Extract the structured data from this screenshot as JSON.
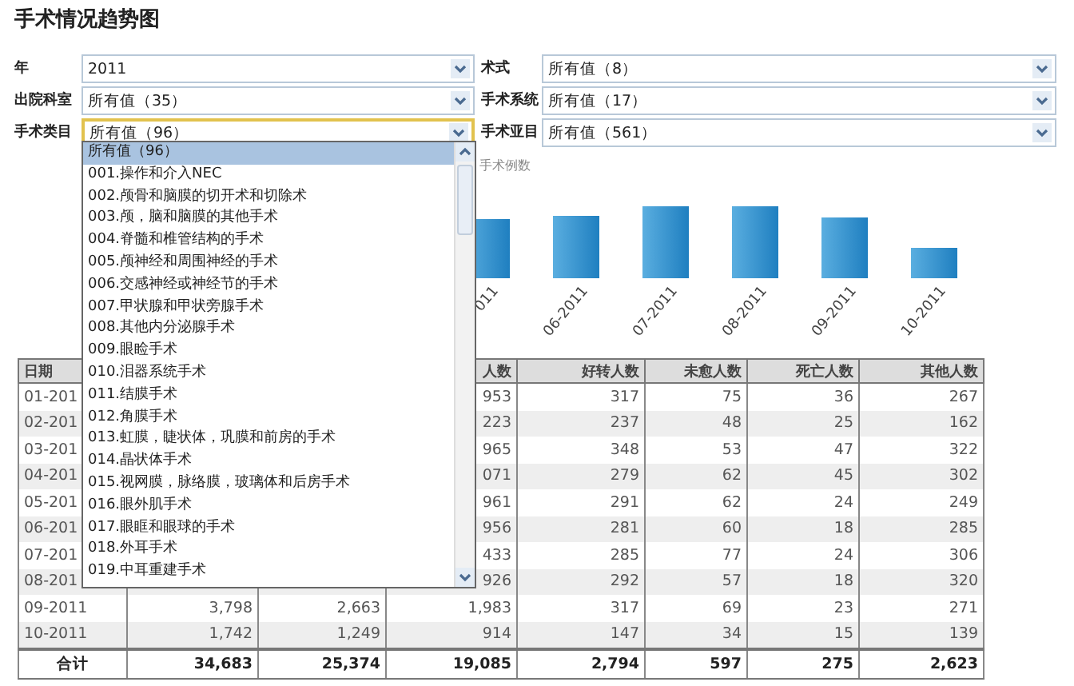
{
  "title": "手术情况趋势图",
  "filters": [
    {
      "label": "年",
      "value": "2011",
      "focused": false
    },
    {
      "label": "术式",
      "value": "所有值（8）",
      "focused": false
    },
    {
      "label": "出院科室",
      "value": "所有值（35）",
      "focused": false
    },
    {
      "label": "手术系统",
      "value": "所有值（17）",
      "focused": false
    },
    {
      "label": "手术类目",
      "value": "所有值（96）",
      "focused": true
    },
    {
      "label": "手术亚目",
      "value": "所有值（561）",
      "focused": false
    }
  ],
  "dropdown": {
    "options": [
      {
        "label": "所有值（96）",
        "selected": true
      },
      {
        "label": "001.操作和介入NEC",
        "selected": false
      },
      {
        "label": "002.颅骨和脑膜的切开术和切除术",
        "selected": false
      },
      {
        "label": "003.颅，脑和脑膜的其他手术",
        "selected": false
      },
      {
        "label": "004.脊髓和椎管结构的手术",
        "selected": false
      },
      {
        "label": "005.颅神经和周围神经的手术",
        "selected": false
      },
      {
        "label": "006.交感神经或神经节的手术",
        "selected": false
      },
      {
        "label": "007.甲状腺和甲状旁腺手术",
        "selected": false
      },
      {
        "label": "008.其他内分泌腺手术",
        "selected": false
      },
      {
        "label": "009.眼睑手术",
        "selected": false
      },
      {
        "label": "010.泪器系统手术",
        "selected": false
      },
      {
        "label": "011.结膜手术",
        "selected": false
      },
      {
        "label": "012.角膜手术",
        "selected": false
      },
      {
        "label": "013.虹膜，睫状体，巩膜和前房的手术",
        "selected": false
      },
      {
        "label": "014.晶状体手术",
        "selected": false
      },
      {
        "label": "015.视网膜，脉络膜，玻璃体和后房手术",
        "selected": false
      },
      {
        "label": "016.眼外肌手术",
        "selected": false
      },
      {
        "label": "017.眼眶和眼球的手术",
        "selected": false
      },
      {
        "label": "018.外耳手术",
        "selected": false
      },
      {
        "label": "019.中耳重建手术",
        "selected": false
      }
    ]
  },
  "chart": {
    "title": "手术例数",
    "x_labels": [
      "011",
      "06-2011",
      "07-2011",
      "08-2011",
      "09-2011",
      "10-2011"
    ]
  },
  "table": {
    "columns": [
      "日期",
      null,
      null,
      "人数",
      "好转人数",
      "未愈人数",
      "死亡人数",
      "其他人数"
    ],
    "rows": [
      {
        "kind": "partial",
        "cells": [
          "01-201",
          "953",
          "317",
          "75",
          "36",
          "267"
        ]
      },
      {
        "kind": "partial",
        "cells": [
          "02-201",
          "223",
          "237",
          "48",
          "25",
          "162"
        ]
      },
      {
        "kind": "partial",
        "cells": [
          "03-201",
          "965",
          "348",
          "53",
          "47",
          "322"
        ]
      },
      {
        "kind": "partial",
        "cells": [
          "04-201",
          "071",
          "279",
          "62",
          "45",
          "302"
        ]
      },
      {
        "kind": "partial",
        "cells": [
          "05-201",
          "961",
          "291",
          "62",
          "24",
          "249"
        ]
      },
      {
        "kind": "partial",
        "cells": [
          "06-201",
          "956",
          "281",
          "60",
          "18",
          "285"
        ]
      },
      {
        "kind": "partial",
        "cells": [
          "07-201",
          "433",
          "285",
          "77",
          "24",
          "306"
        ]
      },
      {
        "kind": "partial",
        "cells": [
          "08-201",
          "926",
          "292",
          "57",
          "18",
          "320"
        ]
      },
      {
        "kind": "data",
        "cells": [
          "09-2011",
          "3,798",
          "2,663",
          "1,983",
          "317",
          "69",
          "23",
          "271"
        ]
      },
      {
        "kind": "data",
        "cells": [
          "10-2011",
          "1,742",
          "1,249",
          "914",
          "147",
          "34",
          "15",
          "139"
        ]
      },
      {
        "kind": "total",
        "cells": [
          "合计",
          "34,683",
          "25,374",
          "19,085",
          "2,794",
          "597",
          "275",
          "2,623"
        ]
      }
    ]
  }
}
